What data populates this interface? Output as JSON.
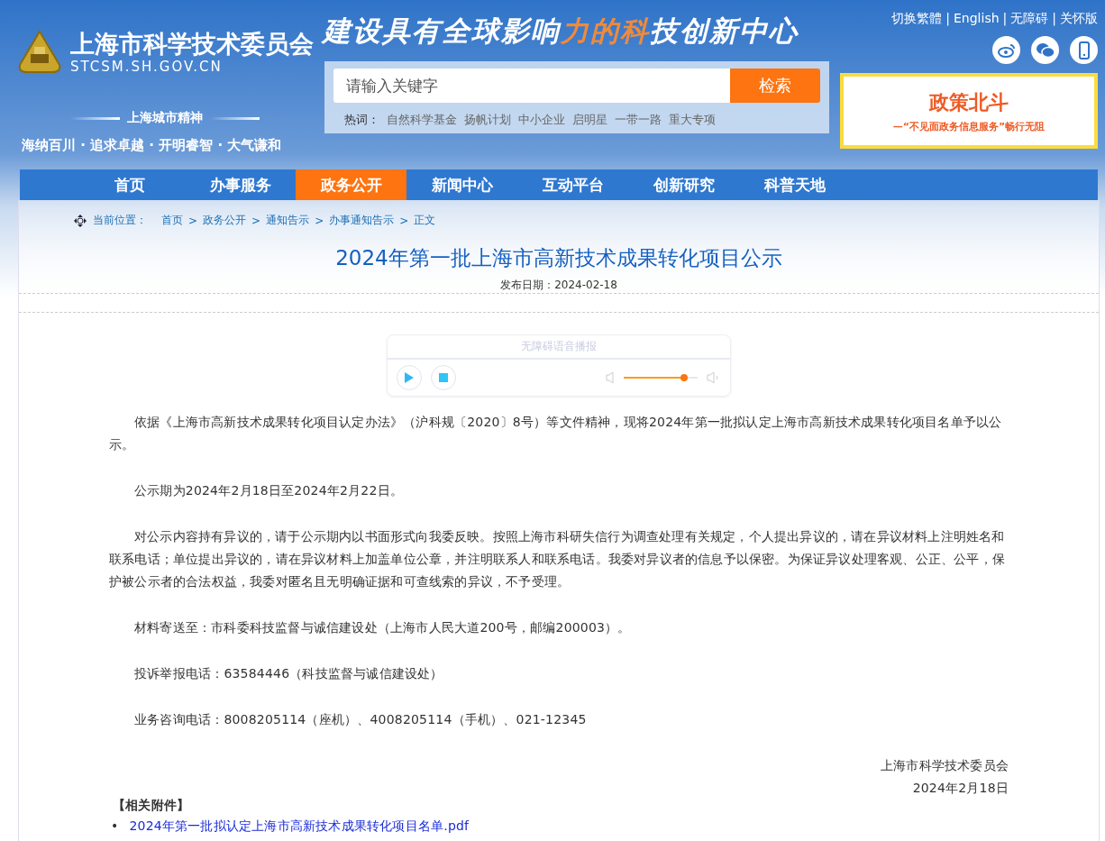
{
  "top_links": [
    "切换繁體",
    "English",
    "无障碍",
    "关怀版"
  ],
  "top_links_separator": "|",
  "site": {
    "name": "上海市科学技术委员会",
    "domain": "STCSM.SH.GOV.CN"
  },
  "slogan": [
    {
      "text": "建设具有全球影响",
      "highlight": false
    },
    {
      "text": "力的科",
      "highlight": true
    },
    {
      "text": "技创新中心",
      "highlight": false
    }
  ],
  "spirit": {
    "title": "上海城市精神",
    "text": "海纳百川 · 追求卓越 · 开明睿智 · 大气谦和"
  },
  "search": {
    "placeholder": "请输入关键字",
    "button": "检索",
    "hot_label": "热词：",
    "hot_words": [
      "自然科学基金",
      "扬帆计划",
      "中小企业",
      "启明星",
      "一带一路",
      "重大专项"
    ]
  },
  "promo": {
    "title": "政策北斗",
    "subtitle": "—“不见面政务信息服务”畅行无阻"
  },
  "nav": [
    {
      "label": "首页",
      "selected": false
    },
    {
      "label": "办事服务",
      "selected": false
    },
    {
      "label": "政务公开",
      "selected": true
    },
    {
      "label": "新闻中心",
      "selected": false
    },
    {
      "label": "互动平台",
      "selected": false
    },
    {
      "label": "创新研究",
      "selected": false
    },
    {
      "label": "科普天地",
      "selected": false
    }
  ],
  "breadcrumb": {
    "label": "当前位置：",
    "separator": ">",
    "items": [
      "首页",
      "政务公开",
      "通知告示",
      "办事通知告示",
      "正文"
    ]
  },
  "article": {
    "title": "2024年第一批上海市高新技术成果转化项目公示",
    "date": "发布日期：2024-02-18",
    "player": {
      "title": "无障碍语音播报",
      "level": 0.82
    },
    "paragraphs": [
      "依据《上海市高新技术成果转化项目认定办法》（沪科规〔2020〕8号）等文件精神，现将2024年第一批拟认定上海市高新技术成果转化项目名单予以公示。",
      "公示期为2024年2月18日至2024年2月22日。",
      "对公示内容持有异议的，请于公示期内以书面形式向我委反映。按照上海市科研失信行为调查处理有关规定，个人提出异议的，请在异议材料上注明姓名和联系电话；单位提出异议的，请在异议材料上加盖单位公章，并注明联系人和联系电话。我委对异议者的信息予以保密。为保证异议处理客观、公正、公平，保护被公示者的合法权益，我委对匿名且无明确证据和可查线索的异议，不予受理。",
      "材料寄送至：市科委科技监督与诚信建设处（上海市人民大道200号，邮编200003）。",
      "投诉举报电话：63584446（科技监督与诚信建设处）",
      "业务咨询电话：8008205114（座机）、4008205114（手机）、021-12345"
    ],
    "signature": [
      "上海市科学技术委员会",
      "2024年2月18日"
    ],
    "attachments_label": "【相关附件】",
    "attachment_bullet": "•",
    "attachments": [
      "2024年第一批拟认定上海市高新技术成果转化项目名单.pdf"
    ]
  }
}
